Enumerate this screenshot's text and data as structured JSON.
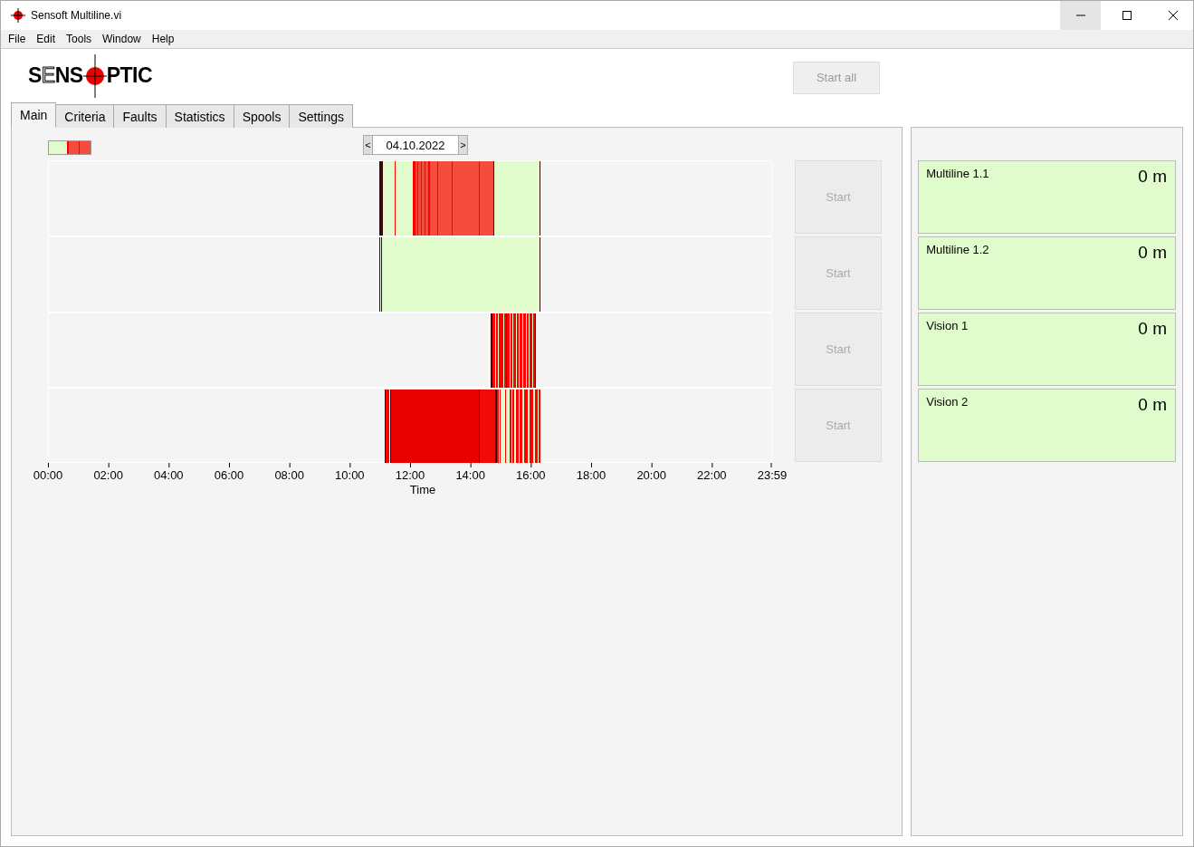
{
  "window": {
    "title": "Sensoft Multiline.vi"
  },
  "menu": [
    "File",
    "Edit",
    "Tools",
    "Window",
    "Help"
  ],
  "logo": {
    "left": "S",
    "outlined": "E",
    "middle": "NS",
    "right": "PTIC"
  },
  "start_all": {
    "label": "Start all",
    "disabled": true
  },
  "tabs": [
    {
      "label": "Main",
      "selected": true
    },
    {
      "label": "Criteria",
      "selected": false
    },
    {
      "label": "Faults",
      "selected": false
    },
    {
      "label": "Statistics",
      "selected": false
    },
    {
      "label": "Spools",
      "selected": false
    },
    {
      "label": "Settings",
      "selected": false
    }
  ],
  "date_picker": {
    "prev": "<",
    "value": "04.10.2022",
    "next": ">"
  },
  "timeline": {
    "ticks": [
      "00:00",
      "02:00",
      "04:00",
      "06:00",
      "08:00",
      "10:00",
      "12:00",
      "14:00",
      "16:00",
      "18:00",
      "20:00",
      "22:00",
      "23:59"
    ],
    "xlabel": "Time"
  },
  "lines": [
    {
      "start": {
        "label": "Start",
        "disabled": true
      },
      "name": "Multiline 1.1",
      "length": "0 m"
    },
    {
      "start": {
        "label": "Start",
        "disabled": true
      },
      "name": "Multiline 1.2",
      "length": "0 m"
    },
    {
      "start": {
        "label": "Start",
        "disabled": true
      },
      "name": "Vision 1",
      "length": "0 m"
    },
    {
      "start": {
        "label": "Start",
        "disabled": true
      },
      "name": "Vision 2",
      "length": "0 m"
    }
  ]
}
